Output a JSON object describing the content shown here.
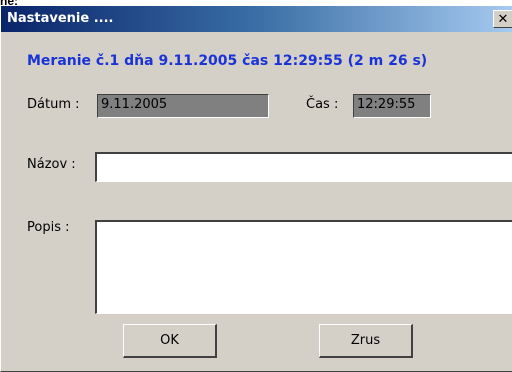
{
  "window": {
    "title": "Nastavenie ....",
    "close_glyph": "✕",
    "top_fragment": "ne:"
  },
  "headline": "Meranie č.1 dňa 9.11.2005 čas 12:29:55 (2 m 26 s)",
  "form": {
    "datum_label": "Dátum :",
    "datum_value": "9.11.2005",
    "cas_label": "Čas :",
    "cas_value": "12:29:55",
    "nazov_label": "Názov :",
    "nazov_value": "",
    "popis_label": "Popis :",
    "popis_value": ""
  },
  "buttons": {
    "ok_label": "OK",
    "cancel_label": "Zrus"
  },
  "colors": {
    "headline": "#1a33d6",
    "dialog_face": "#d4d0c8",
    "title_gradient_start": "#0a246a",
    "title_gradient_end": "#a6caf0"
  }
}
